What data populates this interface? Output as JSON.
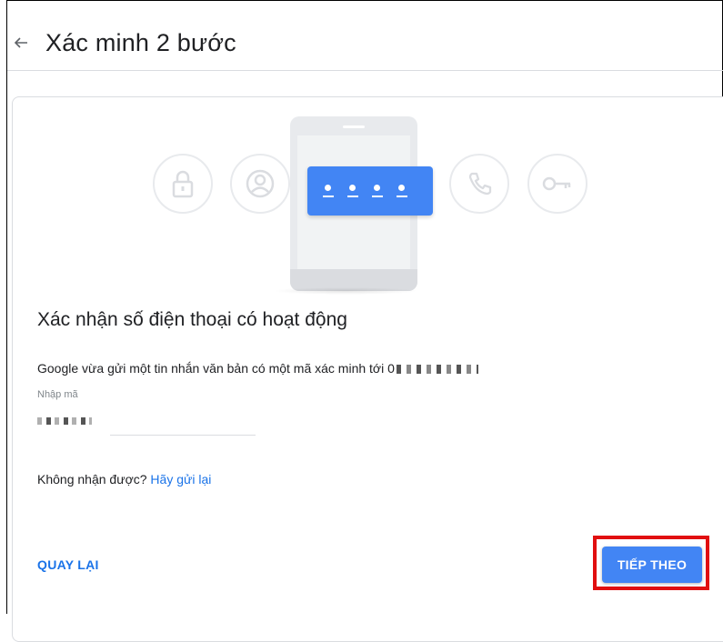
{
  "header": {
    "title": "Xác minh 2 bước",
    "back_icon": "arrow-back-icon"
  },
  "illustration": {
    "icons": [
      "lock-icon",
      "account-icon",
      "phone-call-icon",
      "key-icon"
    ],
    "code_dots": 4,
    "accent": "#4285f4"
  },
  "form": {
    "heading": "Xác nhận số điện thoại có hoạt động",
    "message": "Google vừa gửi một tin nhắn văn bản có một mã xác minh tới 0",
    "code_label": "Nhập mã",
    "code_value": "",
    "resend_prompt": "Không nhận được? ",
    "resend_link": "Hãy gửi lại"
  },
  "actions": {
    "back_label": "QUAY LẠI",
    "next_label": "TIẾP THEO"
  },
  "colors": {
    "link": "#1a73e8",
    "primary": "#4285f4",
    "highlight": "#e10f10"
  }
}
